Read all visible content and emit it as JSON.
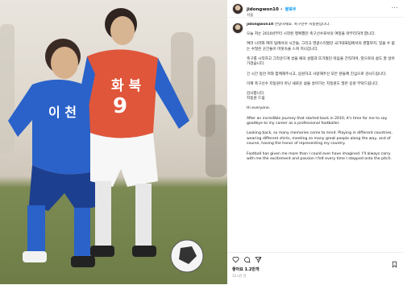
{
  "post": {
    "username": "jidongwon10",
    "follow_label": "팔로우",
    "location": "서울",
    "more_label": "···"
  },
  "photo": {
    "jersey_front_text": "화 북",
    "jersey_front_number": "9",
    "jersey_blue_text": "이 천",
    "description_colors": {
      "red_kit": "#e0563a",
      "blue_kit": "#2a62c9",
      "grass": "#6e7c47"
    }
  },
  "caption": {
    "paragraphs": [
      "안녕하세요. 축구선수 지동원입니다.",
      "오늘 저는 2010년부터 시작된 행복했던 축구선수로서의 여정을 마무리하려 합니다.",
      "여러 나라와 여러 팀에서의 시간들, 그리고 영광스러웠던 국가대표팀에서의 경험까지, 잊을 수 없는 수많은 순간들이 머릿속을 스쳐 지나갑니다.",
      "축구를 시작하고 그라운드에 섰을 때의 설렘과 뜨거웠던 마음을 간직하며, 앞으로의 삶도 잘 살아가겠습니다.",
      "긴 시간 동안 저와 함께해주시고, 응원하고 사랑해주신 모든 분들께 진심으로 감사드립니다.",
      "이제 축구선수 지동원이 아닌 새로운 삶을 살아가는 지동원도 많은 응원 부탁드립니다.",
      "감사합니다.\n지동원 드림",
      "Hi everyone.",
      "After an incredible journey that started back in 2010, it's time for me to say goodbye to my career as a professional footballer.",
      "Looking back, so many memories come to mind. Playing in different countries, wearing different shirts, meeting so many great people along the way, and of course, having the honor of representing my country.",
      "Football has given me more than I could ever have imagined. I'll always carry with me the excitement and passion I felt every time I stepped onto the pitch."
    ]
  },
  "actions": {
    "likes": "좋아요 1.2만개",
    "timestamp": "12시간 전"
  }
}
